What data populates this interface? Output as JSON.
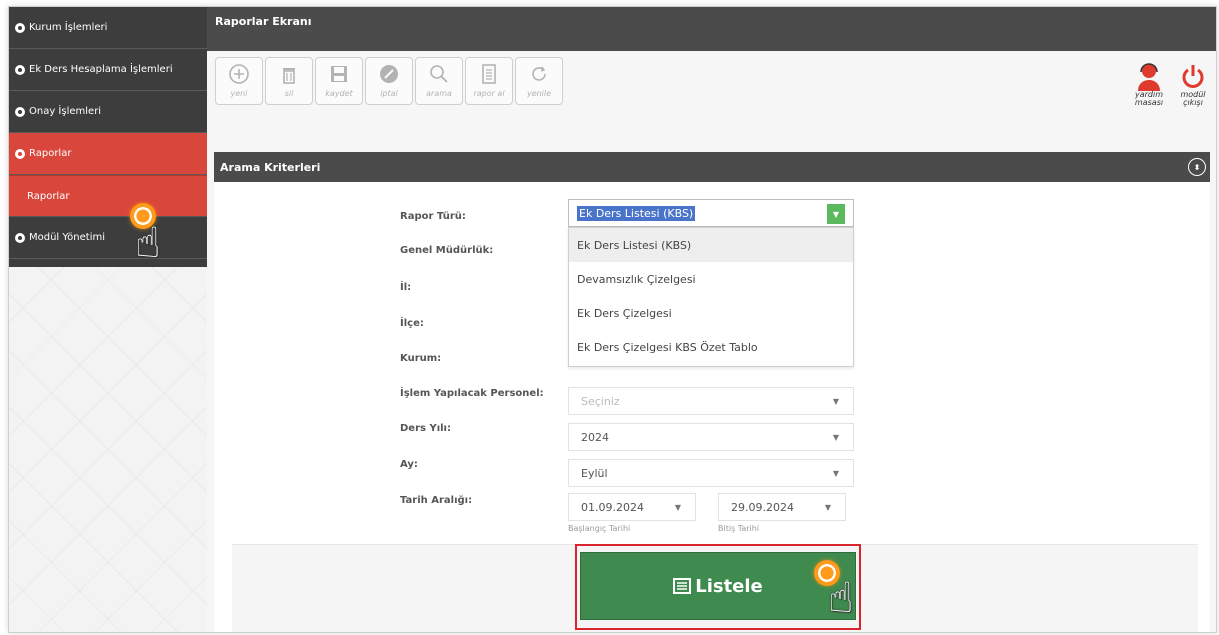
{
  "sidebar": {
    "items": [
      {
        "label": "Kurum İşlemleri"
      },
      {
        "label": "Ek Ders Hesaplama İşlemleri"
      },
      {
        "label": "Onay İşlemleri"
      },
      {
        "label": "Raporlar"
      },
      {
        "label": "Raporlar"
      },
      {
        "label": "Modül Yönetimi"
      }
    ]
  },
  "header": {
    "title": "Raporlar Ekranı"
  },
  "toolbar": {
    "buttons": [
      {
        "label": "yeni",
        "icon": "plus-circle-icon"
      },
      {
        "label": "sil",
        "icon": "trash-icon"
      },
      {
        "label": "kaydet",
        "icon": "save-icon"
      },
      {
        "label": "iptal",
        "icon": "cancel-icon"
      },
      {
        "label": "arama",
        "icon": "search-icon"
      },
      {
        "label": "rapor al",
        "icon": "document-icon"
      },
      {
        "label": "yenile",
        "icon": "refresh-icon"
      }
    ],
    "help_label_1": "yardım",
    "help_label_2": "masası",
    "exit_label_1": "modül",
    "exit_label_2": "çıkışı"
  },
  "section": {
    "title": "Arama Kriterleri"
  },
  "form": {
    "rapor_turu_label": "Rapor Türü:",
    "rapor_turu_value": "Ek Ders Listesi (KBS)",
    "genel_mudurluk_label": "Genel Müdürlük:",
    "il_label": "İl:",
    "ilce_label": "İlçe:",
    "kurum_label": "Kurum:",
    "personel_label": "İşlem Yapılacak Personel:",
    "personel_placeholder": "Seçiniz",
    "ders_yili_label": "Ders Yılı:",
    "ders_yili_value": "2024",
    "ay_label": "Ay:",
    "ay_value": "Eylül",
    "tarih_label": "Tarih Aralığı:",
    "start_date": "01.09.2024",
    "start_hint": "Başlangıç Tarihi",
    "end_date": "29.09.2024",
    "end_hint": "Bitiş Tarihi"
  },
  "dropdown": {
    "options": [
      "Ek Ders Listesi (KBS)",
      "Devamsızlık Çizelgesi",
      "Ek Ders Çizelgesi",
      "Ek Ders Çizelgesi KBS Özet Tablo"
    ]
  },
  "list_button": {
    "label": "Listele"
  },
  "colors": {
    "sidebar_dark": "#3d3d3d",
    "active_red": "#d9473c",
    "button_green": "#3f8a4e"
  }
}
